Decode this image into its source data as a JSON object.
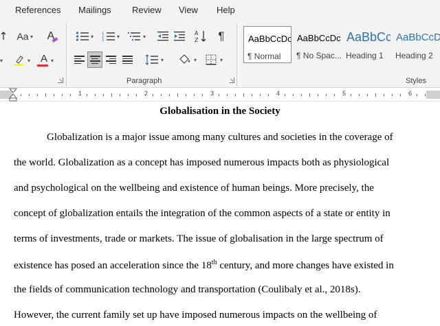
{
  "menu": {
    "tabs": [
      "References",
      "Mailings",
      "Review",
      "View",
      "Help"
    ]
  },
  "ribbon": {
    "font_group": {
      "change_case_label": "Aa",
      "clear_format_label": "A",
      "font_color_label": "A",
      "highlight_color": "#ffff00",
      "font_color": "#e03030"
    },
    "paragraph_group": {
      "label": "Paragraph",
      "sort_label": "A↓Z",
      "pilcrow_label": "¶"
    },
    "styles_group": {
      "label": "Styles",
      "items": [
        {
          "sample": "AaBbCcDc",
          "name": "¶ Normal",
          "selected": true
        },
        {
          "sample": "AaBbCcDc",
          "name": "¶ No Spac...",
          "selected": false
        },
        {
          "sample": "AaBbCc",
          "name": "Heading 1",
          "selected": false
        },
        {
          "sample": "AaBbCcD",
          "name": "Heading 2",
          "selected": false
        }
      ]
    }
  },
  "ruler": {
    "numbers": [
      "1",
      "2",
      "3",
      "4",
      "5",
      "6"
    ]
  },
  "document": {
    "title": "Globalisation in the Society",
    "lines": [
      "Globalization is a major issue among many cultures and societies in the coverage of",
      "the world. Globalization as a concept has imposed numerous impacts both as physiological",
      "and psychological on the wellbeing and existence of human beings. More precisely, the",
      "concept of globalization entails the integration of the common aspects of a state or entity in",
      "terms of investments, trade or markets. The issue of globalisation in the large spectrum of",
      "existence has posed an acceleration since the 18",
      "th",
      " century, and more changes have existed in",
      "the fields of communication technology and transportation (Coulibaly et al., 2018s).",
      "However, the current family set up have imposed numerous impacts on the wellbeing of"
    ]
  }
}
